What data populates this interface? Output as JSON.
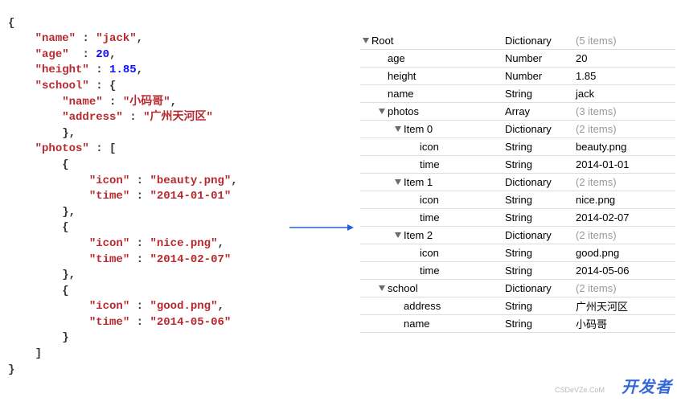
{
  "code": {
    "name_key": "\"name\"",
    "name_val": "\"jack\"",
    "age_key": "\"age\"",
    "age_val": "20",
    "height_key": "\"height\"",
    "height_val": "1.85",
    "school_key": "\"school\"",
    "school_name_key": "\"name\"",
    "school_name_val": "\"小码哥\"",
    "school_addr_key": "\"address\"",
    "school_addr_val": "\"广州天河区\"",
    "photos_key": "\"photos\"",
    "p0_icon_key": "\"icon\"",
    "p0_icon_val": "\"beauty.png\"",
    "p0_time_key": "\"time\"",
    "p0_time_val": "\"2014-01-01\"",
    "p1_icon_key": "\"icon\"",
    "p1_icon_val": "\"nice.png\"",
    "p1_time_key": "\"time\"",
    "p1_time_val": "\"2014-02-07\"",
    "p2_icon_key": "\"icon\"",
    "p2_icon_val": "\"good.png\"",
    "p2_time_key": "\"time\"",
    "p2_time_val": "\"2014-05-06\""
  },
  "tree": {
    "rows": [
      {
        "indent": 0,
        "expandable": true,
        "key": "Root",
        "type": "Dictionary",
        "val": "(5 items)",
        "gray": true
      },
      {
        "indent": 1,
        "expandable": false,
        "key": "age",
        "type": "Number",
        "val": "20",
        "gray": false
      },
      {
        "indent": 1,
        "expandable": false,
        "key": "height",
        "type": "Number",
        "val": "1.85",
        "gray": false
      },
      {
        "indent": 1,
        "expandable": false,
        "key": "name",
        "type": "String",
        "val": "jack",
        "gray": false
      },
      {
        "indent": 1,
        "expandable": true,
        "key": "photos",
        "type": "Array",
        "val": "(3 items)",
        "gray": true
      },
      {
        "indent": 2,
        "expandable": true,
        "key": "Item 0",
        "type": "Dictionary",
        "val": "(2 items)",
        "gray": true
      },
      {
        "indent": 3,
        "expandable": false,
        "key": "icon",
        "type": "String",
        "val": "beauty.png",
        "gray": false
      },
      {
        "indent": 3,
        "expandable": false,
        "key": "time",
        "type": "String",
        "val": "2014-01-01",
        "gray": false
      },
      {
        "indent": 2,
        "expandable": true,
        "key": "Item 1",
        "type": "Dictionary",
        "val": "(2 items)",
        "gray": true
      },
      {
        "indent": 3,
        "expandable": false,
        "key": "icon",
        "type": "String",
        "val": "nice.png",
        "gray": false
      },
      {
        "indent": 3,
        "expandable": false,
        "key": "time",
        "type": "String",
        "val": "2014-02-07",
        "gray": false
      },
      {
        "indent": 2,
        "expandable": true,
        "key": "Item 2",
        "type": "Dictionary",
        "val": "(2 items)",
        "gray": true
      },
      {
        "indent": 3,
        "expandable": false,
        "key": "icon",
        "type": "String",
        "val": "good.png",
        "gray": false
      },
      {
        "indent": 3,
        "expandable": false,
        "key": "time",
        "type": "String",
        "val": "2014-05-06",
        "gray": false
      },
      {
        "indent": 1,
        "expandable": true,
        "key": "school",
        "type": "Dictionary",
        "val": "(2 items)",
        "gray": true
      },
      {
        "indent": 2,
        "expandable": false,
        "key": "address",
        "type": "String",
        "val": "广州天河区",
        "gray": false
      },
      {
        "indent": 2,
        "expandable": false,
        "key": "name",
        "type": "String",
        "val": "小码哥",
        "gray": false
      }
    ]
  },
  "watermark": {
    "main": "开发者",
    "sub": "CSDeVZe.CoM"
  }
}
